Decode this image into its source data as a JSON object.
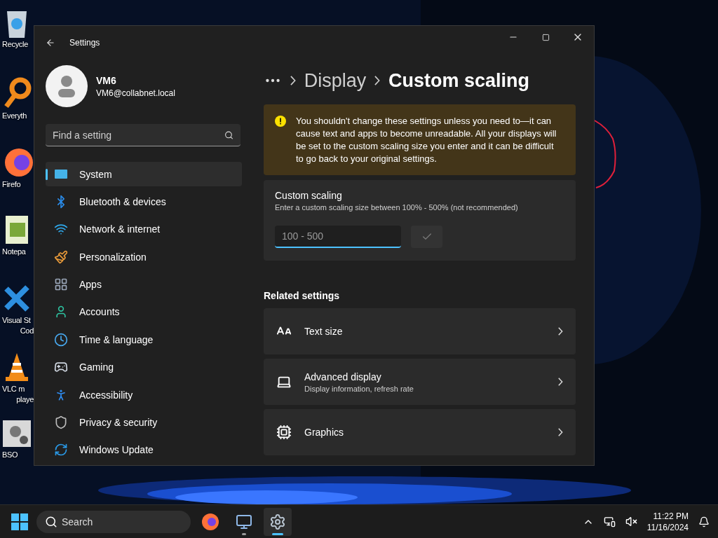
{
  "desktop_icons": [
    {
      "kind": "recycle",
      "lines": [
        "Recycle"
      ]
    },
    {
      "kind": "magnifier",
      "lines": [
        "Everyth"
      ]
    },
    {
      "kind": "browser",
      "lines": [
        "Firefo"
      ]
    },
    {
      "kind": "notepad",
      "lines": [
        "Notepa"
      ]
    },
    {
      "kind": "code",
      "lines": [
        "Visual St",
        "Cod"
      ]
    },
    {
      "kind": "cone",
      "lines": [
        "VLC m",
        "playe"
      ]
    },
    {
      "kind": "gears",
      "lines": [
        "BSO"
      ]
    }
  ],
  "window": {
    "title": "Settings"
  },
  "account": {
    "name": "VM6",
    "email": "VM6@collabnet.local"
  },
  "search": {
    "placeholder": "Find a setting"
  },
  "nav": [
    {
      "kind": "system",
      "label": "System",
      "selected": true
    },
    {
      "kind": "bluetooth",
      "label": "Bluetooth & devices",
      "selected": false
    },
    {
      "kind": "network",
      "label": "Network & internet",
      "selected": false
    },
    {
      "kind": "brush",
      "label": "Personalization",
      "selected": false
    },
    {
      "kind": "apps",
      "label": "Apps",
      "selected": false
    },
    {
      "kind": "accounts",
      "label": "Accounts",
      "selected": false
    },
    {
      "kind": "time",
      "label": "Time & language",
      "selected": false
    },
    {
      "kind": "gaming",
      "label": "Gaming",
      "selected": false
    },
    {
      "kind": "accessibility",
      "label": "Accessibility",
      "selected": false
    },
    {
      "kind": "privacy",
      "label": "Privacy & security",
      "selected": false
    },
    {
      "kind": "update",
      "label": "Windows Update",
      "selected": false
    }
  ],
  "breadcrumb": [
    "Display",
    "Custom scaling"
  ],
  "warning": {
    "text": "You shouldn't change these settings unless you need to—it can cause text and apps to become unreadable. All your displays will be set to the custom scaling size you enter and it can be difficult to go back to your original settings."
  },
  "custom_scaling": {
    "title": "Custom scaling",
    "description": "Enter a custom scaling size between 100% - 500% (not recommended)",
    "input": {
      "placeholder": "100 - 500",
      "focused": true
    },
    "apply_disabled": true
  },
  "related": {
    "heading": "Related settings",
    "items": [
      {
        "kind": "text",
        "title": "Text size"
      },
      {
        "kind": "display",
        "title": "Advanced display",
        "subtitle": "Display information, refresh rate"
      },
      {
        "kind": "graphics",
        "title": "Graphics"
      }
    ]
  },
  "taskbar": {
    "search_placeholder": "Search",
    "apps": [
      {
        "kind": "browser",
        "running": false,
        "active": false
      },
      {
        "kind": "monitor",
        "running": true,
        "active": false
      },
      {
        "kind": "settings",
        "running": true,
        "active": true
      }
    ],
    "time": "11:22 PM",
    "date": "11/16/2024"
  }
}
